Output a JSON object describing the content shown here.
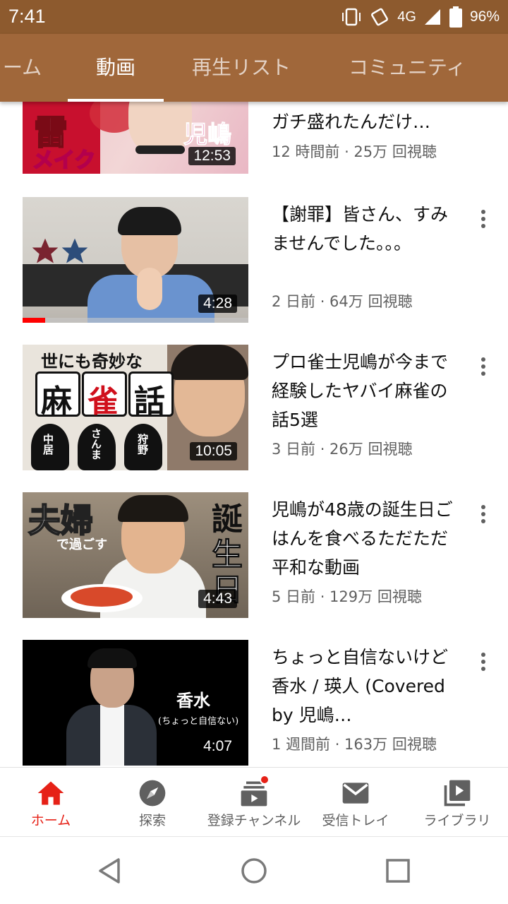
{
  "status_bar": {
    "time": "7:41",
    "network": "4G",
    "battery": "96%"
  },
  "tabs": [
    {
      "label": "ーム",
      "active": false
    },
    {
      "label": "動画",
      "active": true
    },
    {
      "label": "再生リスト",
      "active": false
    },
    {
      "label": "コミュニティ",
      "active": false
    }
  ],
  "videos": [
    {
      "title": "ガチ盛れたんだけ…",
      "meta": "12 時間前 · 25万 回視聴",
      "duration": "12:53",
      "thumb_text": [
        "雷",
        "メイク",
        "児嶋"
      ]
    },
    {
      "title": "【謝罪】皆さん、すみませんでした。。。",
      "meta": "2 日前 · 64万 回視聴",
      "duration": "4:28",
      "watched_fraction": 0.1
    },
    {
      "title": "プロ雀士児嶋が今まで経験したヤバイ麻雀の話5選",
      "meta": "3 日前 · 26万 回視聴",
      "duration": "10:05",
      "thumb_text": [
        "世にも奇妙な",
        "麻",
        "雀",
        "話",
        "中居",
        "さんま",
        "狩野"
      ]
    },
    {
      "title": "児嶋が48歳の誕生日ごはんを食べるただただ平和な動画",
      "meta": "5 日前 · 129万 回視聴",
      "duration": "4:43",
      "thumb_text": [
        "夫婦",
        "で過ごす",
        "誕",
        "生",
        "日"
      ]
    },
    {
      "title": "ちょっと自信ないけど香水 / 瑛人 (Covered by 児嶋…",
      "meta": "1 週間前 · 163万 回視聴",
      "duration": "4:07",
      "thumb_text": [
        "香水",
        "(ちょっと自信ない)"
      ]
    }
  ],
  "bottom_nav": [
    {
      "label": "ホーム",
      "icon": "home-icon",
      "active": true
    },
    {
      "label": "探索",
      "icon": "explore-icon",
      "active": false
    },
    {
      "label": "登録チャンネル",
      "icon": "subscriptions-icon",
      "active": false,
      "badge": true
    },
    {
      "label": "受信トレイ",
      "icon": "inbox-icon",
      "active": false
    },
    {
      "label": "ライブラリ",
      "icon": "library-icon",
      "active": false
    }
  ],
  "colors": {
    "status_bar_bg": "#8d5a2e",
    "tab_bar_bg": "#a0673a",
    "active_red": "#e62117"
  }
}
